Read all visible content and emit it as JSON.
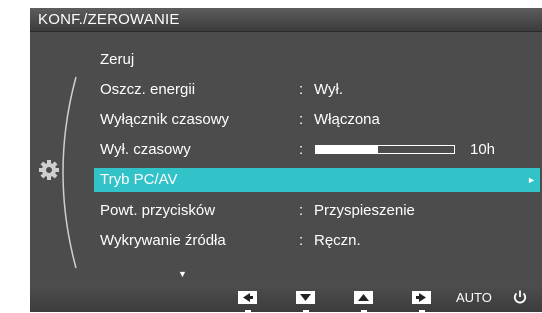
{
  "title": "KONF./ZEROWANIE",
  "menu": [
    {
      "label": "Zeruj",
      "colon": "",
      "value": ""
    },
    {
      "label": "Oszcz. energii",
      "colon": ":",
      "value": "Wył."
    },
    {
      "label": "Wyłącznik czasowy",
      "colon": ":",
      "value": "Włączona"
    },
    {
      "label": "Wył. czasowy",
      "colon": ":",
      "value": ""
    },
    {
      "label": "Tryb PC/AV",
      "colon": "",
      "value": ""
    },
    {
      "label": "Powt. przycisków",
      "colon": ":",
      "value": "Przyspieszenie"
    },
    {
      "label": "Wykrywanie źródła",
      "colon": ":",
      "value": "Ręczn."
    }
  ],
  "timer": {
    "value_text": "10h",
    "level": 0.45
  },
  "selected_item": "Tryb PC/AV",
  "icons": {
    "category": "gear-icon",
    "submenu_arrow": "chevron-right-icon",
    "more": "chevron-down-icon",
    "key_left": "left-arrow-key-icon",
    "key_down": "down-arrow-key-icon",
    "key_up": "up-arrow-key-icon",
    "key_right": "right-arrow-key-icon",
    "power": "power-icon"
  },
  "footer": {
    "auto_label": "AUTO"
  },
  "colors": {
    "highlight": "#32c3c9",
    "panel": "#4c4c4c",
    "text": "#ffffff"
  }
}
